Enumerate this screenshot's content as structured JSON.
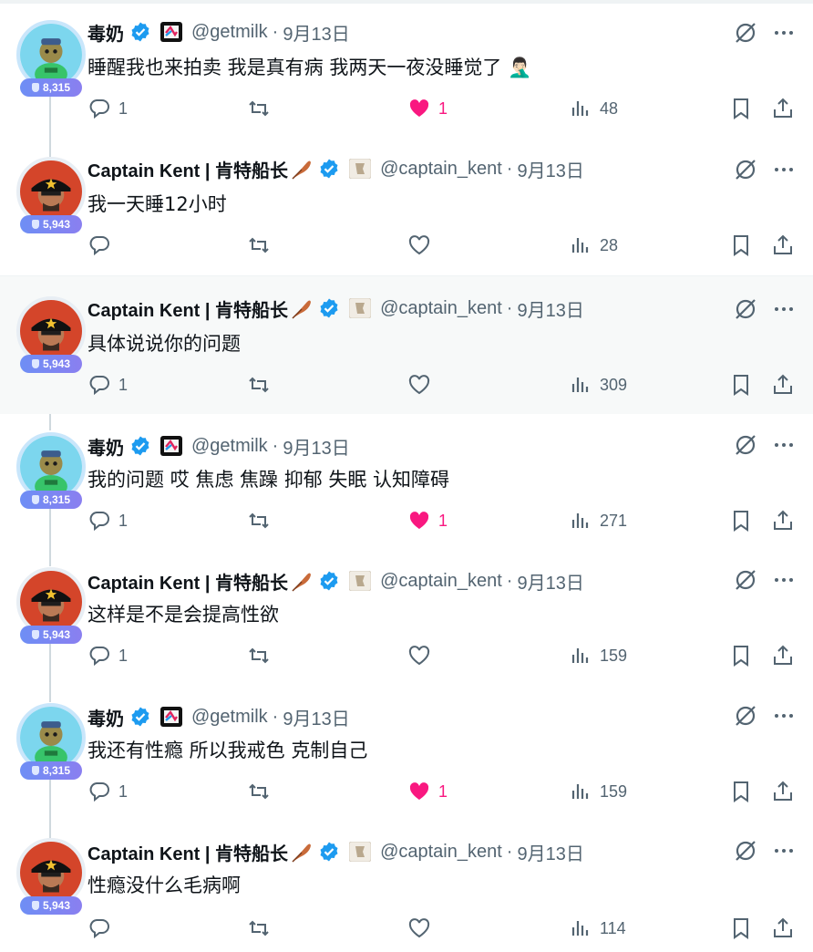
{
  "users": {
    "milk": {
      "name": "毒奶",
      "handle": "@getmilk",
      "score": "8,315"
    },
    "kent": {
      "name": "Captain Kent | 肯特船长",
      "handle": "@captain_kent",
      "score": "5,943"
    }
  },
  "tweets": [
    {
      "author": "毒奶",
      "handle": "@getmilk",
      "date": "9月13日",
      "score": "8,315",
      "text": "睡醒我也来拍卖 我是真有病  我两天一夜没睡觉了 🤦🏻‍♂️",
      "replies": "1",
      "retweets": "",
      "likes": "1",
      "liked": true,
      "views": "48"
    },
    {
      "author": "Captain Kent | 肯特船长",
      "handle": "@captain_kent",
      "date": "9月13日",
      "score": "5,943",
      "text": "我一天睡12小时",
      "replies": "",
      "retweets": "",
      "likes": "",
      "liked": false,
      "views": "28"
    },
    {
      "author": "Captain Kent | 肯特船长",
      "handle": "@captain_kent",
      "date": "9月13日",
      "score": "5,943",
      "text": "具体说说你的问题",
      "replies": "1",
      "retweets": "",
      "likes": "",
      "liked": false,
      "views": "309"
    },
    {
      "author": "毒奶",
      "handle": "@getmilk",
      "date": "9月13日",
      "score": "8,315",
      "text": "我的问题 哎 焦虑 焦躁 抑郁 失眠 认知障碍",
      "replies": "1",
      "retweets": "",
      "likes": "1",
      "liked": true,
      "views": "271"
    },
    {
      "author": "Captain Kent | 肯特船长",
      "handle": "@captain_kent",
      "date": "9月13日",
      "score": "5,943",
      "text": "这样是不是会提高性欲",
      "replies": "1",
      "retweets": "",
      "likes": "",
      "liked": false,
      "views": "159"
    },
    {
      "author": "毒奶",
      "handle": "@getmilk",
      "date": "9月13日",
      "score": "8,315",
      "text": "我还有性瘾 所以我戒色 克制自己",
      "replies": "1",
      "retweets": "",
      "likes": "1",
      "liked": true,
      "views": "159"
    },
    {
      "author": "Captain Kent | 肯特船长",
      "handle": "@captain_kent",
      "date": "9月13日",
      "score": "5,943",
      "text": "性瘾没什么毛病啊",
      "replies": "",
      "retweets": "",
      "likes": "",
      "liked": false,
      "views": "114"
    }
  ],
  "separator": "·",
  "icons": {
    "reply": "reply-icon",
    "retweet": "retweet-icon",
    "like": "heart-icon",
    "views": "views-icon",
    "bookmark": "bookmark-icon",
    "share": "share-icon",
    "grok": "grok-icon",
    "more": "more-icon",
    "verified": "verified-badge-icon",
    "affiliation": "affiliation-badge-icon",
    "feather": "feather-icon"
  },
  "colors": {
    "verified": "#1d9bf0",
    "liked": "#f91880",
    "muted": "#536471",
    "badge": "#7b87f3"
  }
}
